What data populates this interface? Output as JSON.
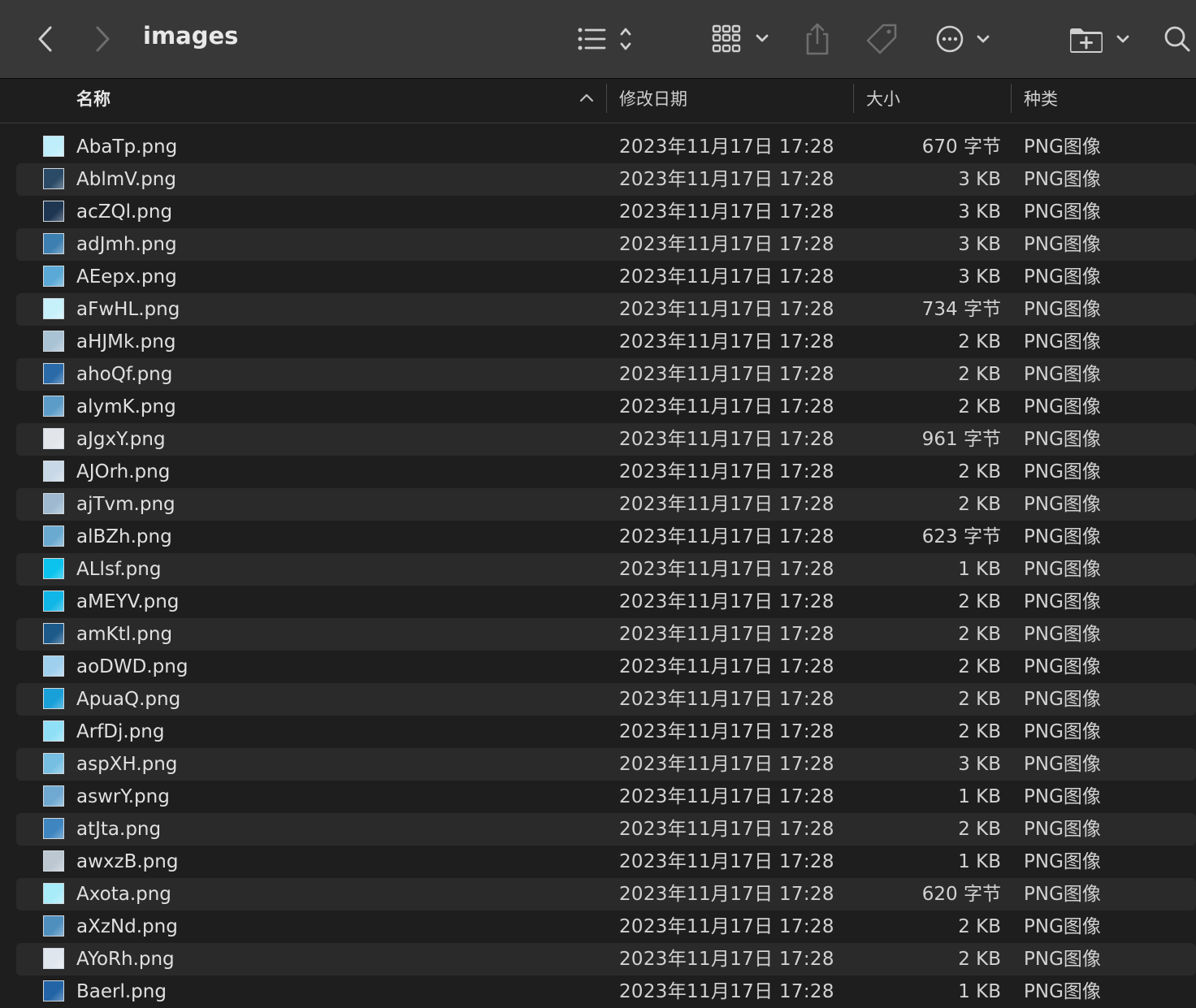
{
  "window": {
    "title": "images"
  },
  "toolbar": {
    "back_icon": "chevron-left-icon",
    "forward_icon": "chevron-right-icon",
    "list_view_icon": "list-view-icon",
    "grid_view_icon": "grid-view-icon",
    "share_icon": "share-icon",
    "tag_icon": "tag-icon",
    "more_icon": "ellipsis-circle-icon",
    "new_folder_icon": "new-folder-icon",
    "search_icon": "search-icon"
  },
  "columns": {
    "name": "名称",
    "date": "修改日期",
    "size": "大小",
    "kind": "种类",
    "sort": "ascending"
  },
  "files": [
    {
      "name": "AbaTp.png",
      "date": "2023年11月17日 17:28",
      "size": "670 字节",
      "kind": "PNG图像",
      "thumb": "#bdeefa"
    },
    {
      "name": "AblmV.png",
      "date": "2023年11月17日 17:28",
      "size": "3 KB",
      "kind": "PNG图像",
      "thumb": "#2b4a66"
    },
    {
      "name": "acZQl.png",
      "date": "2023年11月17日 17:28",
      "size": "3 KB",
      "kind": "PNG图像",
      "thumb": "#1f3652"
    },
    {
      "name": "adJmh.png",
      "date": "2023年11月17日 17:28",
      "size": "3 KB",
      "kind": "PNG图像",
      "thumb": "#3d7fb0"
    },
    {
      "name": "AEepx.png",
      "date": "2023年11月17日 17:28",
      "size": "3 KB",
      "kind": "PNG图像",
      "thumb": "#5aa9d6"
    },
    {
      "name": "aFwHL.png",
      "date": "2023年11月17日 17:28",
      "size": "734 字节",
      "kind": "PNG图像",
      "thumb": "#c6f0fa"
    },
    {
      "name": "aHJMk.png",
      "date": "2023年11月17日 17:28",
      "size": "2 KB",
      "kind": "PNG图像",
      "thumb": "#a9c2d4"
    },
    {
      "name": "ahoQf.png",
      "date": "2023年11月17日 17:28",
      "size": "2 KB",
      "kind": "PNG图像",
      "thumb": "#2a6aa8"
    },
    {
      "name": "alymK.png",
      "date": "2023年11月17日 17:28",
      "size": "2 KB",
      "kind": "PNG图像",
      "thumb": "#5c9cc8"
    },
    {
      "name": "aJgxY.png",
      "date": "2023年11月17日 17:28",
      "size": "961 字节",
      "kind": "PNG图像",
      "thumb": "#e2e6ea"
    },
    {
      "name": "AJOrh.png",
      "date": "2023年11月17日 17:28",
      "size": "2 KB",
      "kind": "PNG图像",
      "thumb": "#c9d8e6"
    },
    {
      "name": "ajTvm.png",
      "date": "2023年11月17日 17:28",
      "size": "2 KB",
      "kind": "PNG图像",
      "thumb": "#9fbad0"
    },
    {
      "name": "alBZh.png",
      "date": "2023年11月17日 17:28",
      "size": "623 字节",
      "kind": "PNG图像",
      "thumb": "#6aaad0"
    },
    {
      "name": "ALlsf.png",
      "date": "2023年11月17日 17:28",
      "size": "1 KB",
      "kind": "PNG图像",
      "thumb": "#0bc3ec"
    },
    {
      "name": "aMEYV.png",
      "date": "2023年11月17日 17:28",
      "size": "2 KB",
      "kind": "PNG图像",
      "thumb": "#10b6e6"
    },
    {
      "name": "amKtl.png",
      "date": "2023年11月17日 17:28",
      "size": "2 KB",
      "kind": "PNG图像",
      "thumb": "#1d5a8a"
    },
    {
      "name": "aoDWD.png",
      "date": "2023年11月17日 17:28",
      "size": "2 KB",
      "kind": "PNG图像",
      "thumb": "#9fd0ee"
    },
    {
      "name": "ApuaQ.png",
      "date": "2023年11月17日 17:28",
      "size": "2 KB",
      "kind": "PNG图像",
      "thumb": "#1aa0d8"
    },
    {
      "name": "ArfDj.png",
      "date": "2023年11月17日 17:28",
      "size": "2 KB",
      "kind": "PNG图像",
      "thumb": "#8fe0f6"
    },
    {
      "name": "aspXH.png",
      "date": "2023年11月17日 17:28",
      "size": "3 KB",
      "kind": "PNG图像",
      "thumb": "#76bfe2"
    },
    {
      "name": "aswrY.png",
      "date": "2023年11月17日 17:28",
      "size": "1 KB",
      "kind": "PNG图像",
      "thumb": "#6fa9d2"
    },
    {
      "name": "atJta.png",
      "date": "2023年11月17日 17:28",
      "size": "2 KB",
      "kind": "PNG图像",
      "thumb": "#3f86c0"
    },
    {
      "name": "awxzB.png",
      "date": "2023年11月17日 17:28",
      "size": "1 KB",
      "kind": "PNG图像",
      "thumb": "#bcc7d2"
    },
    {
      "name": "Axota.png",
      "date": "2023年11月17日 17:28",
      "size": "620 字节",
      "kind": "PNG图像",
      "thumb": "#a8ecfa"
    },
    {
      "name": "aXzNd.png",
      "date": "2023年11月17日 17:28",
      "size": "2 KB",
      "kind": "PNG图像",
      "thumb": "#4f8fbe"
    },
    {
      "name": "AYoRh.png",
      "date": "2023年11月17日 17:28",
      "size": "2 KB",
      "kind": "PNG图像",
      "thumb": "#dfe6ee"
    },
    {
      "name": "Baerl.png",
      "date": "2023年11月17日 17:28",
      "size": "1 KB",
      "kind": "PNG图像",
      "thumb": "#2364a6"
    }
  ]
}
